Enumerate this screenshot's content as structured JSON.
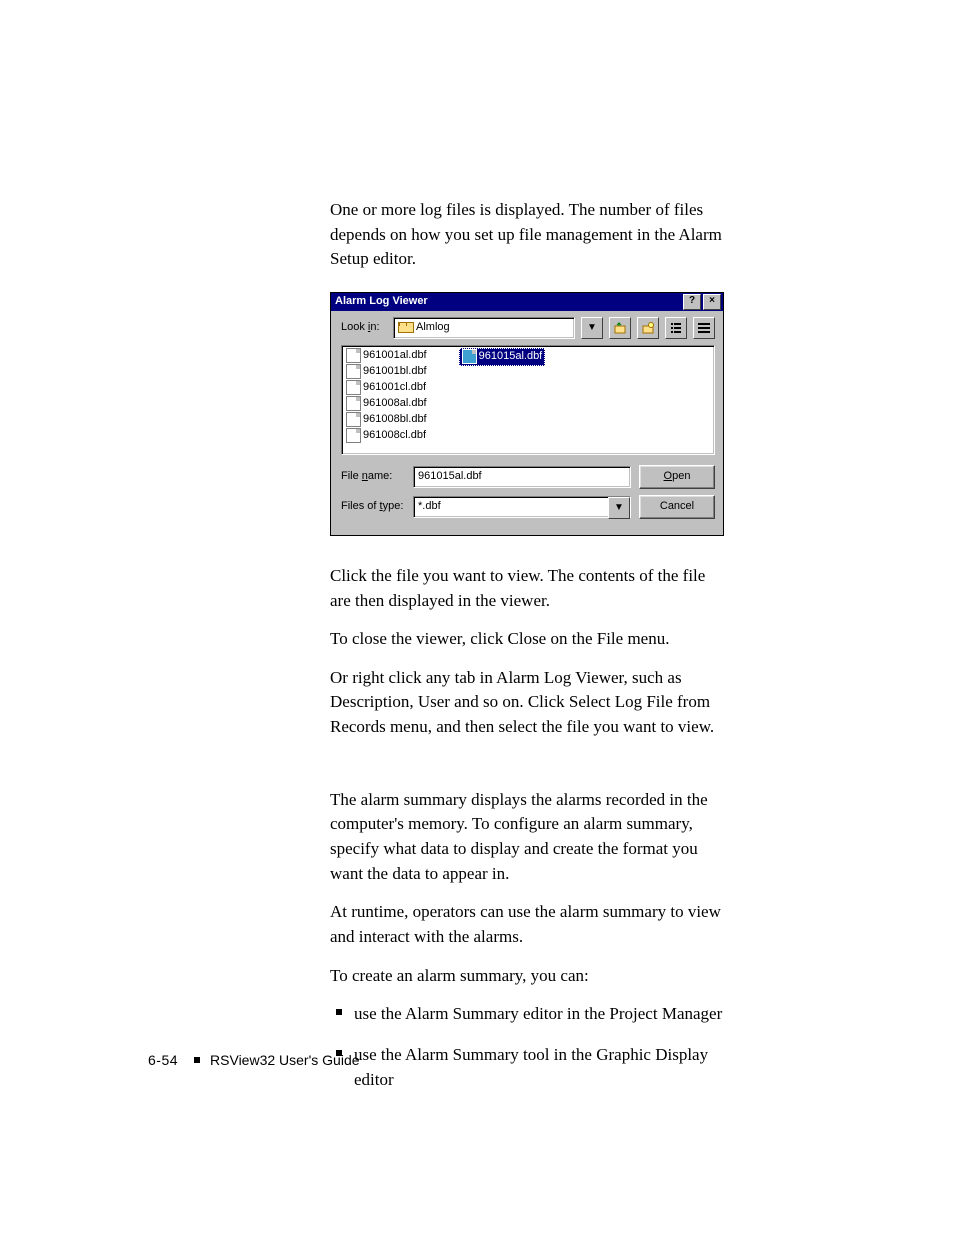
{
  "para1": "One or more log files is displayed. The number of files depends on how you set up file management in the Alarm Setup editor.",
  "dialog": {
    "title": "Alarm Log Viewer",
    "help": "?",
    "close": "×",
    "lookin_label": "Look in:",
    "lookin_value": "Almlog",
    "lookin_underline": "i",
    "files": [
      "961001al.dbf",
      "961001bl.dbf",
      "961001cl.dbf",
      "961008al.dbf",
      "961008bl.dbf",
      "961008cl.dbf"
    ],
    "selected_file": "961015al.dbf",
    "file_name_label": "File name:",
    "file_name_value": "961015al.dbf",
    "type_label": "Files of type:",
    "type_value": "*.dbf",
    "open": "Open",
    "cancel": "Cancel"
  },
  "para2": "Click the file you want to view. The contents of the file are then displayed in the viewer.",
  "para3": "To close the viewer, click Close on the File menu.",
  "para4": "Or right click any tab in Alarm Log Viewer, such as Description, User and so on. Click Select Log File from Records menu, and then select the file you want to view.",
  "para5": "The alarm summary displays the alarms recorded in the computer's memory. To configure an alarm summary, specify what data to display and create the format you want the data to appear in.",
  "para6": "At runtime, operators can use the alarm summary to view and interact with the alarms.",
  "para7": "To create an alarm summary, you can:",
  "bullet1": "use the Alarm Summary editor in the Project Manager",
  "bullet2": "use the Alarm Summary tool in the Graphic Display editor",
  "footer": {
    "page": "6-54",
    "book": "RSView32  User's Guide"
  }
}
